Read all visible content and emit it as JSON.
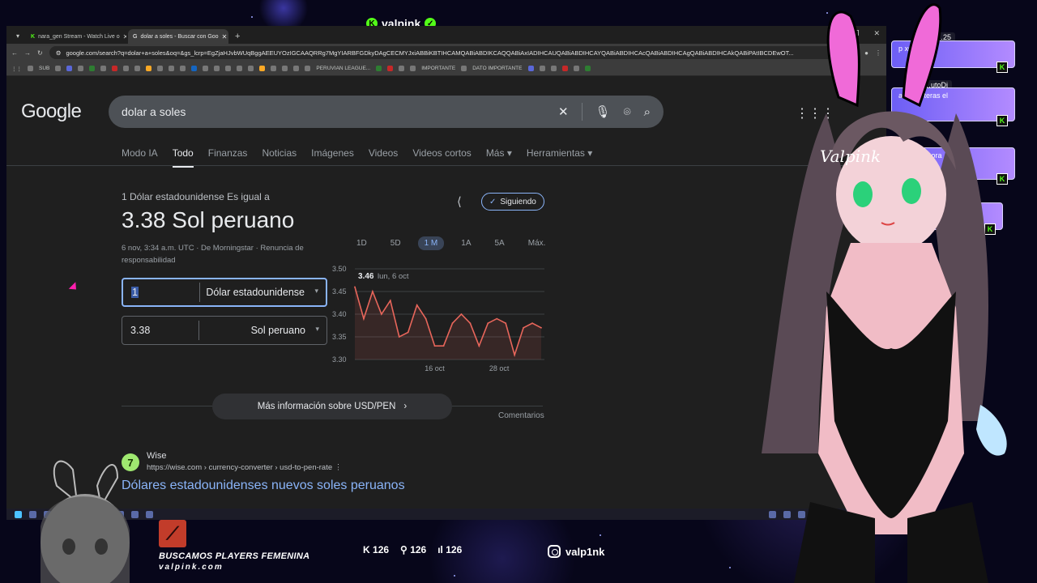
{
  "stream": {
    "channel_name": "valpink",
    "instagram": "valp1nk",
    "promo_line1": "BUSCAMOS PLAYERS FEMENINA",
    "promo_line2": "valpink.com",
    "kick_count": "126",
    "follow_count": "126",
    "viewer_count": "126",
    "avatar_signature": "Valpink"
  },
  "browser": {
    "tabs": [
      {
        "label": "nara_gen Stream - Watch Live o",
        "active": false
      },
      {
        "label": "dolar a soles - Buscar con Goo",
        "active": true
      }
    ],
    "url": "google.com/search?q=dolar+a+soles&oq=&gs_lcrp=EgZjaHJvbWUqBggAEEUYOzIGCAAQRRg7MgYIARBFGDkyDAgCECMYJxiABBiKBTIHCAMQABiABDIKCAQQABiAxIADIHCAUQABiABDIHCAYQABiABDIHCAcQABiABDIHCAgQABiABDIHCAkQABiPAtIBCDEwOT...",
    "bookmarks": [
      "SUB",
      "PERUVIAN LEAGUE...",
      "IMPORTANTE",
      "DATO IMPORTANTE"
    ]
  },
  "google": {
    "logo": "Google",
    "query": "dolar a soles",
    "nav_tabs": [
      "Modo IA",
      "Todo",
      "Finanzas",
      "Noticias",
      "Imágenes",
      "Videos",
      "Videos cortos",
      "Más ▾",
      "Herramientas ▾"
    ],
    "active_tab": "Todo",
    "converter": {
      "subtitle": "1 Dólar estadounidense Es igual a",
      "result": "3.38 Sol peruano",
      "meta": "6 nov, 3:34 a.m. UTC · De Morningstar · Renuncia de responsabilidad",
      "follow_label": "Siguiendo",
      "from_amount": "1",
      "from_currency": "Dólar estadounidense",
      "to_amount": "3.38",
      "to_currency": "Sol peruano",
      "ranges": [
        "1D",
        "5D",
        "1 M",
        "1A",
        "5A",
        "Máx."
      ],
      "active_range": "1 M",
      "more_info": "Más información sobre USD/PEN",
      "comments": "Comentarios"
    },
    "result": {
      "site": "Wise",
      "url": "https://wise.com › currency-converter › usd-to-pen-rate",
      "title": "Dólares estadounidenses nuevos soles peruanos"
    }
  },
  "chart_data": {
    "type": "line",
    "title": "",
    "ylim": [
      3.3,
      3.5
    ],
    "yticks": [
      "3.50",
      "3.45",
      "3.40",
      "3.35",
      "3.30"
    ],
    "xticks": [
      "16 oct",
      "28 oct"
    ],
    "tooltip_value": "3.46",
    "tooltip_date": "lun, 6 oct",
    "series": [
      {
        "values": [
          3.46,
          3.39,
          3.45,
          3.4,
          3.43,
          3.35,
          3.36,
          3.42,
          3.39,
          3.33,
          3.33,
          3.38,
          3.4,
          3.38,
          3.33,
          3.38,
          3.39,
          3.38,
          3.31,
          3.37,
          3.38,
          3.37
        ]
      }
    ],
    "color": "#e8665b",
    "grid": true
  },
  "chat": [
    {
      "user": "…25",
      "text": "p xd"
    },
    {
      "user": "…utoDj",
      "text": "a las doteras el"
    },
    {
      "user": "",
      "text": "tre 1 a 4 hora"
    },
    {
      "user": "",
      "text": "ne"
    }
  ]
}
